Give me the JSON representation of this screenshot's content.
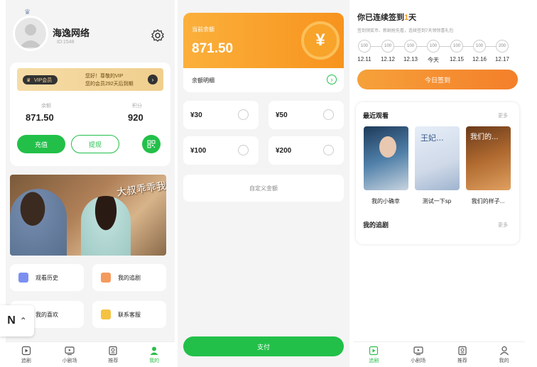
{
  "profile": {
    "name": "海逸网络",
    "id_text": "ID:1548",
    "vip_badge": "VIP会员",
    "vip_greeting": "您好！尊敬的VIP",
    "vip_days": "您的会员292天后到期",
    "balance_label": "余额",
    "balance": "871.50",
    "points_label": "积分",
    "points": "920",
    "recharge_label": "充值",
    "withdraw_label": "提现"
  },
  "menu": {
    "history": "观看历史",
    "follow": "我的追剧",
    "likes": "我的喜欢",
    "service": "联系客服"
  },
  "banner": {
    "caption": "大叔乖乖我"
  },
  "floating": {
    "letter": "N"
  },
  "tabs": [
    {
      "label": "追剧",
      "icon": "play-square-icon"
    },
    {
      "label": "小剧场",
      "icon": "tv-icon"
    },
    {
      "label": "推荐",
      "icon": "recommend-icon"
    },
    {
      "label": "我的",
      "icon": "user-icon"
    }
  ],
  "recharge": {
    "balance_label": "当前余额",
    "balance": "871.50",
    "detail_label": "余额明细",
    "options": [
      "¥30",
      "¥50",
      "¥100",
      "¥200"
    ],
    "custom_label": "自定义金额",
    "pay_label": "支付"
  },
  "checkin": {
    "title_prefix": "你已连续签到",
    "days": "1",
    "title_suffix": "天",
    "subtitle": "签到领奖币、新剧抢先看，连续签到7天领惊喜礼包",
    "rewards": [
      "100",
      "100",
      "100",
      "100",
      "100",
      "100",
      "200"
    ],
    "dates": [
      "12.11",
      "12.12",
      "12.13",
      "今天",
      "12.15",
      "12.16",
      "12.17"
    ],
    "button_label": "今日签到",
    "recent_title": "最近观看",
    "more_label": "更多",
    "posters": [
      "我的小确幸",
      "测试一下sp",
      "我们的样子..."
    ],
    "follow_title": "我的追剧",
    "follow_more": "更多"
  },
  "colors": {
    "green": "#22c049",
    "orange": "#f7931e",
    "vip_gold": "#f5d79a"
  }
}
